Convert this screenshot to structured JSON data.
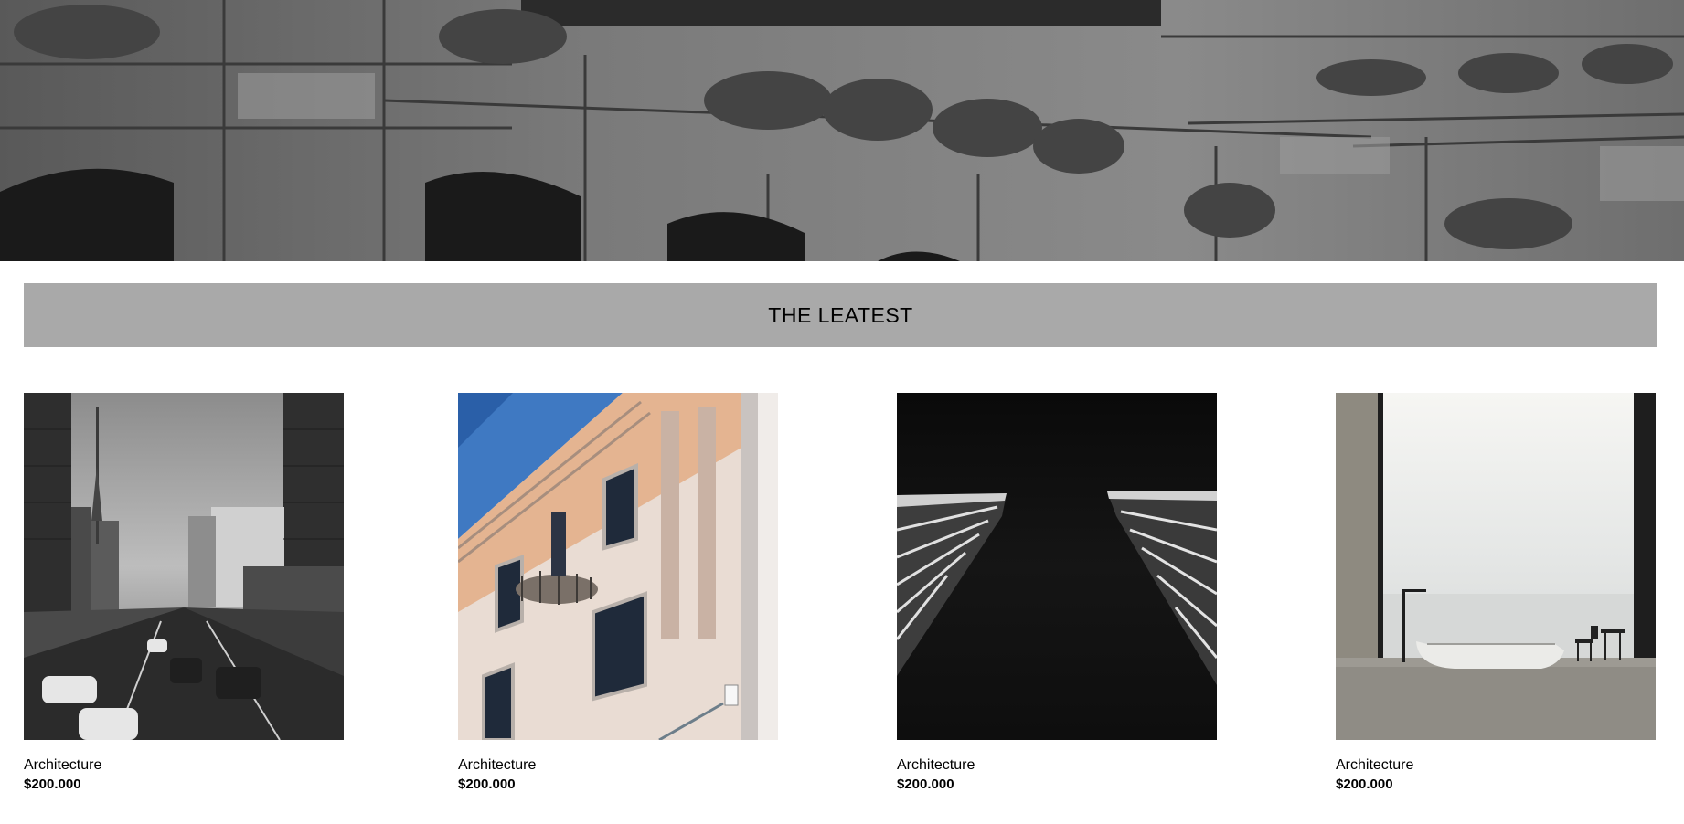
{
  "hero": {
    "image": "ornate-stone-building-facade-bw"
  },
  "section": {
    "title": "THE LEATEST"
  },
  "products": [
    {
      "image": "city-avenue-bw",
      "category": "Architecture",
      "price": "$200.000"
    },
    {
      "image": "ornate-brick-building-balcony",
      "category": "Architecture",
      "price": "$200.000"
    },
    {
      "image": "skyscrapers-looking-up-dark",
      "category": "Architecture",
      "price": "$200.000"
    },
    {
      "image": "minimal-bathroom-ocean-view",
      "category": "Architecture",
      "price": "$200.000"
    }
  ]
}
